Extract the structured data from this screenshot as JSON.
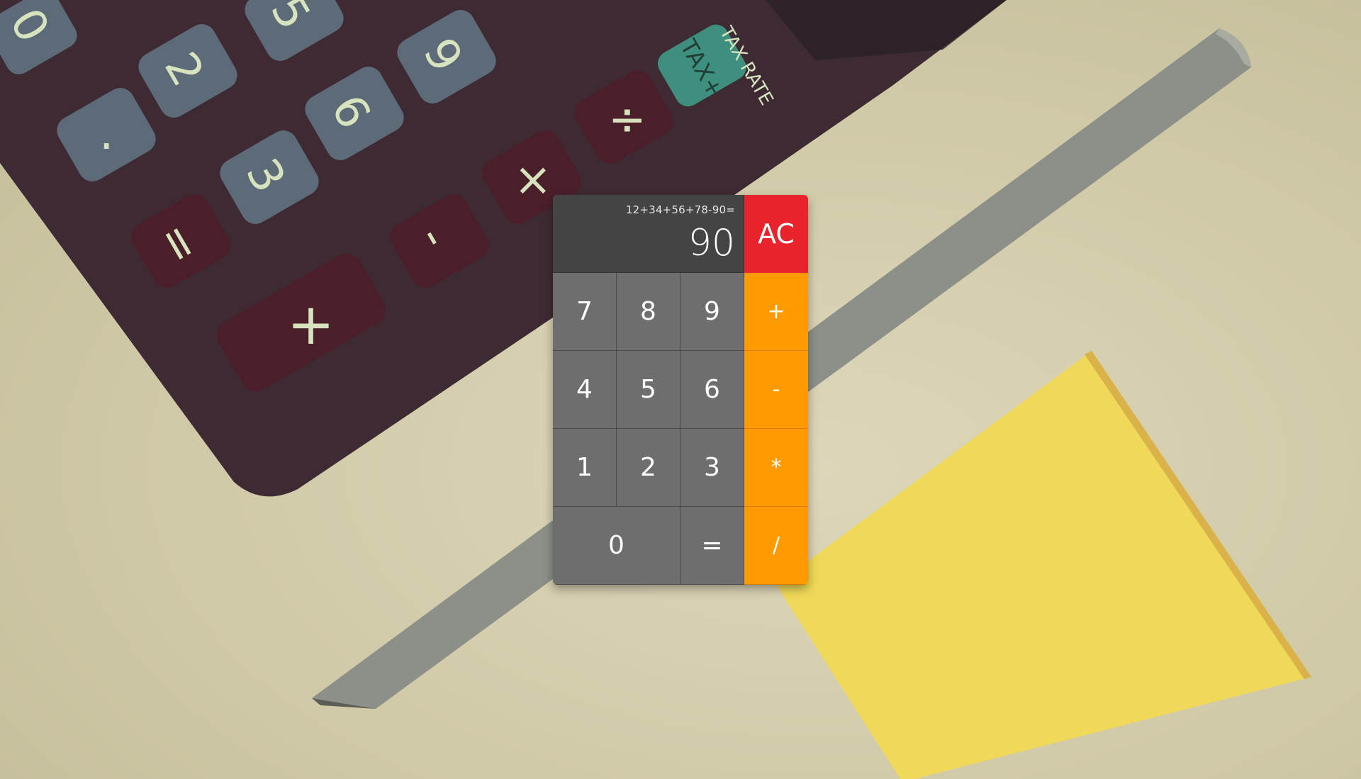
{
  "background": {
    "description_icon": "calculator-photo-background",
    "colors": {
      "desk": "#d6d0b2",
      "calculator_body": "#3e2a33",
      "note": "#f0d958",
      "pencil": "#8c9088"
    },
    "decor_keys": [
      "0",
      "2",
      "5",
      "6",
      "9",
      ".",
      "3",
      "=",
      "-",
      "+",
      "×",
      "÷",
      "TAX+",
      "%"
    ],
    "tax_rate_label": "TAX RATE"
  },
  "calculator": {
    "expression": "12+34+56+78-90=",
    "result": "90",
    "clear_label": "AC",
    "keys": {
      "k7": "7",
      "k8": "8",
      "k9": "9",
      "k4": "4",
      "k5": "5",
      "k6": "6",
      "k1": "1",
      "k2": "2",
      "k3": "3",
      "k0": "0",
      "equals": "=",
      "plus": "+",
      "minus": "-",
      "multiply": "*",
      "divide": "/"
    },
    "colors": {
      "display": "#444444",
      "number": "#6e6e6e",
      "operator": "#ff9a00",
      "clear": "#e8232b"
    }
  }
}
